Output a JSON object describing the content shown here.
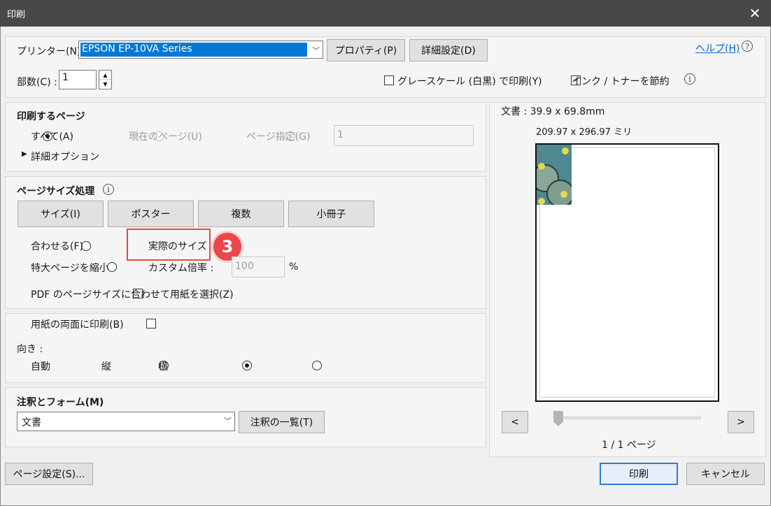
{
  "window": {
    "title": "印刷",
    "close": "✕"
  },
  "printer": {
    "label": "プリンター(N) :",
    "value": "EPSON EP-10VA Series",
    "properties_button": "プロパティ(P)",
    "advanced_button": "詳細設定(D)",
    "help_link": "ヘルプ(H)",
    "help_icon": "?"
  },
  "copies": {
    "label": "部数(C) :",
    "value": "1"
  },
  "options": {
    "grayscale_label": "グレースケール (白黒) で印刷(Y)",
    "grayscale_checked": false,
    "save_ink_label": "インク / トナーを節約",
    "save_ink_checked": true,
    "info_icon": "i"
  },
  "pages_to_print": {
    "title": "印刷するページ",
    "all": "すべて(A)",
    "current": "現在のページ(U)",
    "range": "ページ指定(G)",
    "range_value": "1",
    "more_options": "詳細オプション",
    "expand_icon": "▶"
  },
  "page_sizing": {
    "title": "ページサイズ処理",
    "info_icon": "i",
    "tabs": [
      "サイズ(I)",
      "ポスター",
      "複数",
      "小冊子"
    ],
    "fit": "合わせる(F)",
    "actual_size": "実際のサイズ",
    "shrink": "特大ページを縮小",
    "custom_scale": "カスタム倍率 :",
    "custom_value": "100",
    "percent": "%",
    "pdf_page_size": "PDF のページサイズに合わせて用紙を選択(Z)",
    "step_badge": "3",
    "highlight_color": "#e8474b"
  },
  "duplex": {
    "label": "用紙の両面に印刷(B)",
    "orientation_label": "向き :",
    "auto": "自動",
    "portrait": "縦",
    "landscape": "横"
  },
  "comments": {
    "title": "注釈とフォーム(M)",
    "value": "文書",
    "summary_button": "注釈の一覧(T)"
  },
  "preview": {
    "doc_size": "文書 : 39.9 x 69.8mm",
    "paper_size": "209.97 x 296.97 ミリ",
    "prev": "<",
    "next": ">",
    "page_indicator": "1 / 1 ページ"
  },
  "footer": {
    "page_setup": "ページ設定(S)...",
    "print": "印刷",
    "cancel": "キャンセル"
  }
}
